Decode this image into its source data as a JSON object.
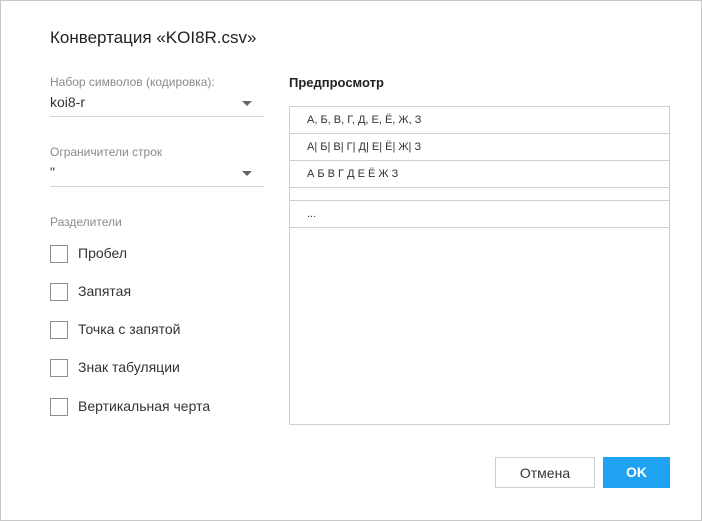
{
  "dialog": {
    "title": "Конвертация «KOI8R.csv»"
  },
  "charset": {
    "label": "Набор символов (кодировка):",
    "value": "koi8-r"
  },
  "row_delimiter": {
    "label": "Ограничители строк",
    "value": "\""
  },
  "separators": {
    "label": "Разделители",
    "items": [
      {
        "label": "Пробел",
        "checked": false
      },
      {
        "label": "Запятая",
        "checked": false
      },
      {
        "label": "Точка с запятой",
        "checked": false
      },
      {
        "label": "Знак табуляции",
        "checked": false
      },
      {
        "label": "Вертикальная черта",
        "checked": false
      }
    ]
  },
  "preview": {
    "title": "Предпросмотр",
    "rows": [
      "А, Б, В, Г, Д, Е, Ё, Ж, З",
      "А| Б| В| Г| Д| Е| Ё| Ж| З",
      "А Б В Г Д Е Ё Ж З",
      "",
      "..."
    ]
  },
  "buttons": {
    "cancel_label": "Отмена",
    "ok_label": "OK"
  },
  "colors": {
    "accent": "#1ea2f1"
  }
}
